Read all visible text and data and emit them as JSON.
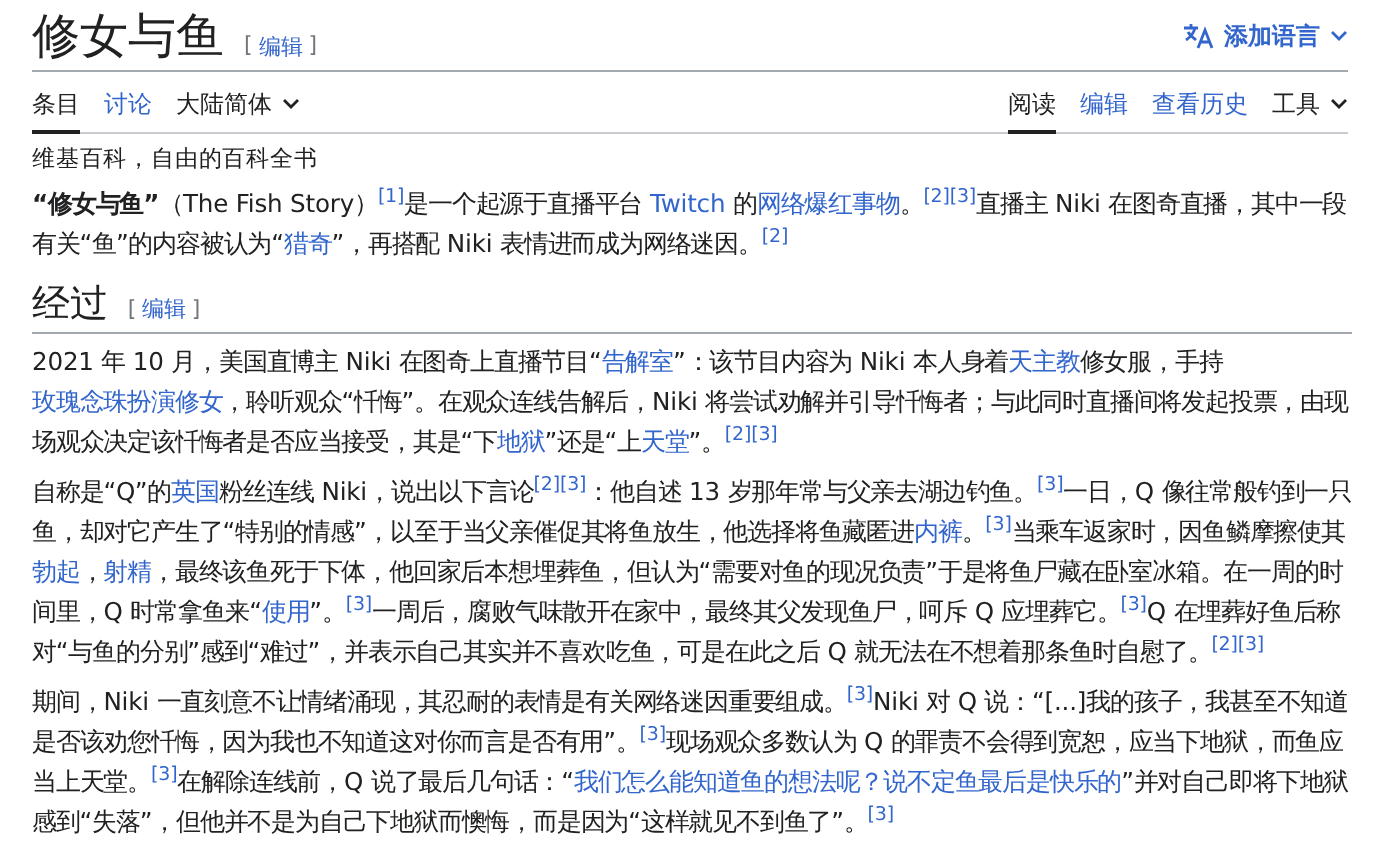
{
  "page": {
    "title": "修女与鱼",
    "edit_link": {
      "open": "[",
      "label": "编辑",
      "close": "]"
    },
    "language_button": "添加语言"
  },
  "tabs_left": [
    {
      "label": "条目",
      "kind": "tab",
      "selected": true
    },
    {
      "label": "讨论",
      "kind": "tab",
      "selected": false
    },
    {
      "label": "大陆简体",
      "kind": "dropdown",
      "selected": false
    }
  ],
  "tabs_right": [
    {
      "label": "阅读",
      "kind": "tab",
      "selected": true
    },
    {
      "label": "编辑",
      "kind": "tab",
      "selected": false
    },
    {
      "label": "查看历史",
      "kind": "tab",
      "selected": false
    },
    {
      "label": "工具",
      "kind": "dropdown",
      "selected": false
    }
  ],
  "tagline": "维基百科，自由的百科全书",
  "intro": [
    {
      "kind": "bold",
      "text": "“修女与鱼”"
    },
    {
      "kind": "text",
      "text": "（The Fish Story）"
    },
    {
      "kind": "ref",
      "text": "[1]"
    },
    {
      "kind": "text",
      "text": "是一个起源于直播平台 "
    },
    {
      "kind": "link",
      "text": "Twitch"
    },
    {
      "kind": "text",
      "text": " 的"
    },
    {
      "kind": "link",
      "text": "网络爆红事物"
    },
    {
      "kind": "text",
      "text": "。"
    },
    {
      "kind": "ref",
      "text": "[2]"
    },
    {
      "kind": "ref",
      "text": "[3]"
    },
    {
      "kind": "text",
      "text": "直播主 Niki 在图奇直播，其中一段有关“鱼”的内容被认为“"
    },
    {
      "kind": "link",
      "text": "猎奇"
    },
    {
      "kind": "text",
      "text": "”，再搭配 Niki 表情进而成为网络迷因。"
    },
    {
      "kind": "ref",
      "text": "[2]"
    }
  ],
  "sections": [
    {
      "heading": "经过",
      "edit_link": {
        "open": "[",
        "label": "编辑",
        "close": "]"
      },
      "paragraphs": [
        [
          {
            "kind": "text",
            "text": "2021 年 10 月，美国直博主 Niki 在图奇上直播节目“"
          },
          {
            "kind": "link",
            "text": "告解室"
          },
          {
            "kind": "text",
            "text": "”：该节目内容为 Niki 本人身着"
          },
          {
            "kind": "link",
            "text": "天主教"
          },
          {
            "kind": "text",
            "text": "修女服，手持"
          },
          {
            "kind": "link",
            "text": "玫瑰念珠扮演修女"
          },
          {
            "kind": "text",
            "text": "，聆听观众“忏悔”。在观众连线告解后，Niki 将尝试劝解并引导忏悔者；与此同时直播间将发起投票，由现场观众决定该忏悔者是否应当接受，其是“下"
          },
          {
            "kind": "link",
            "text": "地狱"
          },
          {
            "kind": "text",
            "text": "”还是“上"
          },
          {
            "kind": "link",
            "text": "天堂"
          },
          {
            "kind": "text",
            "text": "”。"
          },
          {
            "kind": "ref",
            "text": "[2]"
          },
          {
            "kind": "ref",
            "text": "[3]"
          }
        ],
        [
          {
            "kind": "text",
            "text": "自称是“Q”的"
          },
          {
            "kind": "link",
            "text": "英国"
          },
          {
            "kind": "text",
            "text": "粉丝连线 Niki，说出以下言论"
          },
          {
            "kind": "ref",
            "text": "[2]"
          },
          {
            "kind": "ref",
            "text": "[3]"
          },
          {
            "kind": "text",
            "text": "：他自述 13 岁那年常与父亲去湖边钓鱼。"
          },
          {
            "kind": "ref",
            "text": "[3]"
          },
          {
            "kind": "text",
            "text": "一日，Q 像往常般钓到一只鱼，却对它产生了“特别的情感”，以至于当父亲催促其将鱼放生，他选择将鱼藏匿进"
          },
          {
            "kind": "link",
            "text": "内裤"
          },
          {
            "kind": "text",
            "text": "。"
          },
          {
            "kind": "ref",
            "text": "[3]"
          },
          {
            "kind": "text",
            "text": "当乘车返家时，因鱼鳞摩擦使其"
          },
          {
            "kind": "link",
            "text": "勃起"
          },
          {
            "kind": "text",
            "text": "，"
          },
          {
            "kind": "link",
            "text": "射精"
          },
          {
            "kind": "text",
            "text": "，最终该鱼死于下体，他回家后本想埋葬鱼，但认为“需要对鱼的现况负责”于是将鱼尸藏在卧室冰箱。在一周的时间里，Q 时常拿鱼来“"
          },
          {
            "kind": "link",
            "text": "使用"
          },
          {
            "kind": "text",
            "text": "”。"
          },
          {
            "kind": "ref",
            "text": "[3]"
          },
          {
            "kind": "text",
            "text": "一周后，腐败气味散开在家中，最终其父发现鱼尸，呵斥 Q 应埋葬它。"
          },
          {
            "kind": "ref",
            "text": "[3]"
          },
          {
            "kind": "text",
            "text": "Q 在埋葬好鱼后称对“与鱼的分别”感到“难过”，并表示自己其实并不喜欢吃鱼，可是在此之后 Q 就无法在不想着那条鱼时自慰了。"
          },
          {
            "kind": "ref",
            "text": "[2]"
          },
          {
            "kind": "ref",
            "text": "[3]"
          }
        ],
        [
          {
            "kind": "text",
            "text": "期间，Niki 一直刻意不让情绪涌现，其忍耐的表情是有关网络迷因重要组成。"
          },
          {
            "kind": "ref",
            "text": "[3]"
          },
          {
            "kind": "text",
            "text": "Niki 对 Q 说：“[...]我的孩子，我甚至不知道是否该劝您忏悔，因为我也不知道这对你而言是否有用”。"
          },
          {
            "kind": "ref",
            "text": "[3]"
          },
          {
            "kind": "text",
            "text": "现场观众多数认为 Q 的罪责不会得到宽恕，应当下地狱，而鱼应当上天堂。"
          },
          {
            "kind": "ref",
            "text": "[3]"
          },
          {
            "kind": "text",
            "text": "在解除连线前，Q 说了最后几句话：“"
          },
          {
            "kind": "link",
            "text": "我们怎么能知道鱼的想法呢？说不定鱼最后是快乐的"
          },
          {
            "kind": "text",
            "text": "”并对自己即将下地狱感到“失落”，但他并不是为自己下地狱而懊悔，而是因为“这样就见不到鱼了”。"
          },
          {
            "kind": "ref",
            "text": "[3]"
          }
        ]
      ]
    }
  ]
}
